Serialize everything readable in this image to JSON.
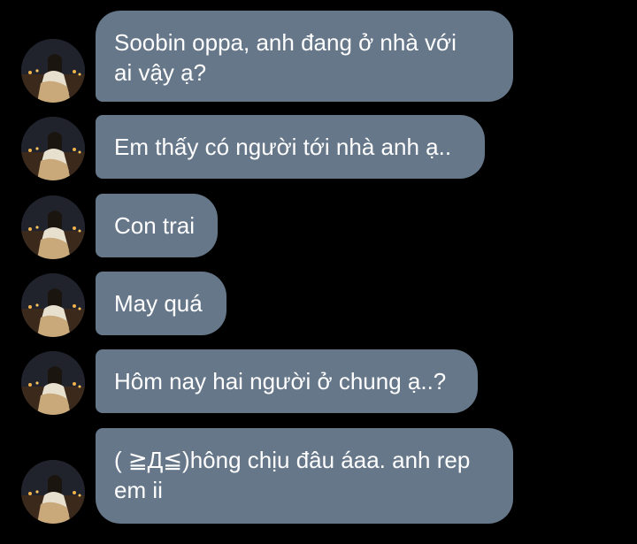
{
  "conversation": {
    "messages": [
      {
        "text": "Soobin oppa, anh đang ở nhà với\nai vậy ạ?"
      },
      {
        "text": "Em thấy có người tới nhà anh ạ.."
      },
      {
        "text": "Con trai"
      },
      {
        "text": "May quá"
      },
      {
        "text": "Hôm nay hai người ở chung ạ..?"
      },
      {
        "text": "( ≧Д≦)hông chịu đâu áaa. anh rep\nem ii"
      }
    ],
    "avatar_icon": "profile-photo-avatar",
    "colors": {
      "background": "#000000",
      "bubble": "#66778a",
      "text": "#ffffff"
    }
  }
}
